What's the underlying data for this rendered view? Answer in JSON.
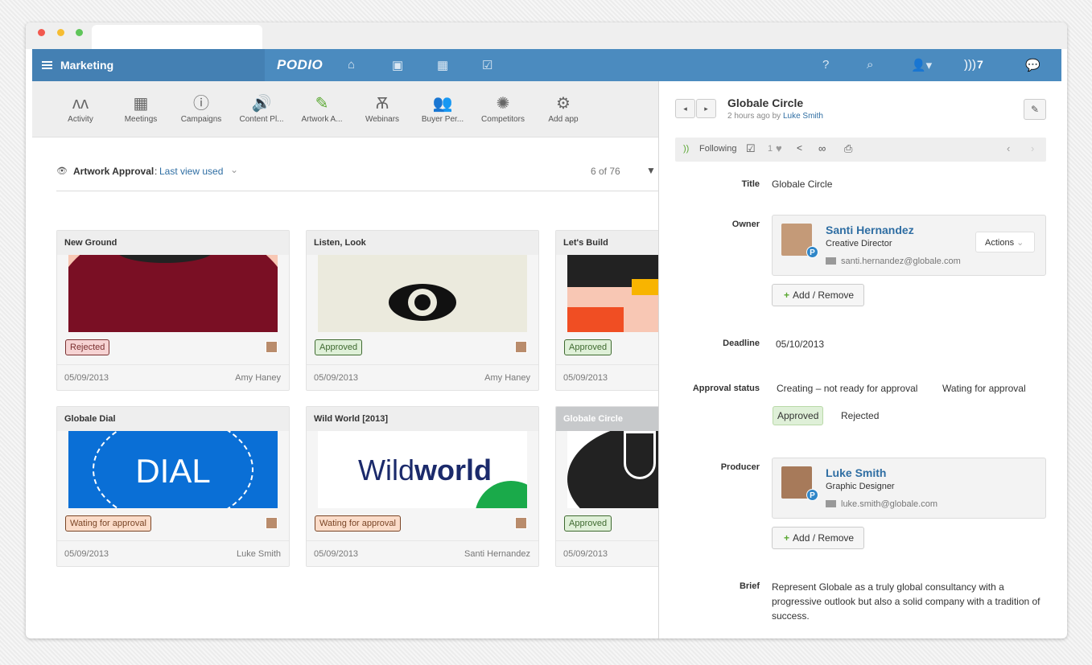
{
  "topbar": {
    "workspace": "Marketing",
    "logo": "PODIO",
    "notifications": "7"
  },
  "apps": [
    {
      "label": "Activity",
      "icon": "activity-icon",
      "glyph": "ʌʌ"
    },
    {
      "label": "Meetings",
      "icon": "calendar-icon",
      "glyph": "▦"
    },
    {
      "label": "Campaigns",
      "icon": "info-icon",
      "glyph": "ⓘ"
    },
    {
      "label": "Content Pl...",
      "icon": "speaker-icon",
      "glyph": "🔊"
    },
    {
      "label": "Artwork A...",
      "icon": "brush-icon",
      "glyph": "✎"
    },
    {
      "label": "Webinars",
      "icon": "antenna-icon",
      "glyph": "Ѫ"
    },
    {
      "label": "Buyer Per...",
      "icon": "people-icon",
      "glyph": "👥"
    },
    {
      "label": "Competitors",
      "icon": "sun-icon",
      "glyph": "✺"
    },
    {
      "label": "Add app",
      "icon": "add-app-icon",
      "glyph": "⚙"
    }
  ],
  "view": {
    "app": "Artwork Approval",
    "sep": ":",
    "name": "Last view used",
    "count": "6 of 76"
  },
  "cards": [
    {
      "title": "New Ground",
      "status": "Rejected",
      "status_class": "rej",
      "date": "05/09/2013",
      "by": "Amy Haney"
    },
    {
      "title": "Listen, Look",
      "status": "Approved",
      "status_class": "appr",
      "date": "05/09/2013",
      "by": "Amy Haney"
    },
    {
      "title": "Let's Build",
      "status": "Approved",
      "status_class": "appr",
      "date": "05/09/2013",
      "by": ""
    },
    {
      "title": "Globale Dial",
      "status": "Wating for approval",
      "status_class": "wait",
      "date": "05/09/2013",
      "by": "Luke Smith"
    },
    {
      "title": "Wild World [2013]",
      "status": "Wating for approval",
      "status_class": "wait",
      "date": "05/09/2013",
      "by": "Santi Hernandez"
    },
    {
      "title": "Globale Circle",
      "status": "Approved",
      "status_class": "appr",
      "date": "05/09/2013",
      "by": ""
    }
  ],
  "art": {
    "dial": "DIAL",
    "wild1": "Wild",
    "wild2": "world"
  },
  "item": {
    "title": "Globale Circle",
    "meta_time": "2 hours ago by",
    "meta_user": "Luke Smith",
    "following": "Following",
    "likes": "1",
    "fields": {
      "title_label": "Title",
      "title_value": "Globale Circle",
      "owner_label": "Owner",
      "owner": {
        "name": "Santi Hernandez",
        "role": "Creative Director",
        "email": "santi.hernandez@globale.com",
        "actions": "Actions"
      },
      "add_remove": "Add / Remove",
      "deadline_label": "Deadline",
      "deadline_value": "05/10/2013",
      "status_label": "Approval status",
      "status_options": [
        "Creating – not ready for approval",
        "Wating for approval",
        "Approved",
        "Rejected"
      ],
      "producer_label": "Producer",
      "producer": {
        "name": "Luke Smith",
        "role": "Graphic Designer",
        "email": "luke.smith@globale.com"
      },
      "brief_label": "Brief",
      "brief_value": "Represent Globale as a truly global consultancy with a progressive outlook but also a solid company with a tradition of success."
    }
  }
}
